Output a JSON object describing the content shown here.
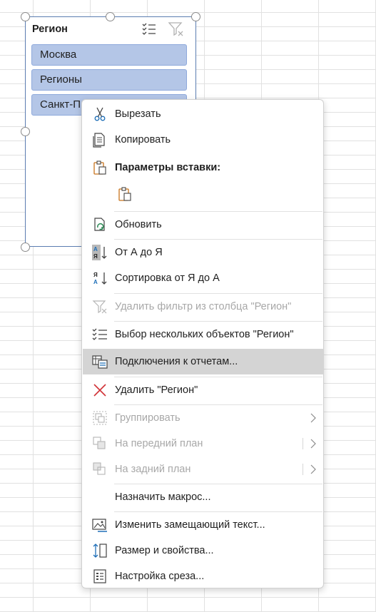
{
  "slicer": {
    "title": "Регион",
    "items": [
      {
        "label": "Москва",
        "selected": true
      },
      {
        "label": "Регионы",
        "selected": true
      },
      {
        "label": "Санкт-П",
        "selected": true
      }
    ],
    "icons": [
      "multi-select-icon",
      "clear-filter-icon"
    ]
  },
  "menu": {
    "items": [
      {
        "label": "Вырезать",
        "icon": "scissors-icon",
        "enabled": true
      },
      {
        "label": "Копировать",
        "icon": "copy-icon",
        "enabled": true
      },
      {
        "label": "Параметры вставки:",
        "icon": "paste-icon",
        "enabled": true
      },
      {
        "label": "",
        "icon": "paste-option-icon",
        "enabled": true
      },
      {
        "label": "Обновить",
        "icon": "refresh-icon",
        "enabled": true
      },
      {
        "label": "От А до Я",
        "icon": "sort-az-icon",
        "enabled": true
      },
      {
        "label": "Сортировка от Я до А",
        "icon": "sort-za-icon",
        "enabled": true
      },
      {
        "label": "Удалить фильтр из столбца \"Регион\"",
        "icon": "clear-filter-icon",
        "enabled": false
      },
      {
        "label": "Выбор нескольких объектов \"Регион\"",
        "icon": "multi-select-icon",
        "enabled": true
      },
      {
        "label": "Подключения к отчетам...",
        "icon": "report-connections-icon",
        "enabled": true,
        "highlighted": true
      },
      {
        "label": "Удалить \"Регион\"",
        "icon": "delete-icon",
        "enabled": true
      },
      {
        "label": "Группировать",
        "icon": "group-icon",
        "enabled": false,
        "submenu": true
      },
      {
        "label": "На передний план",
        "icon": "bring-forward-icon",
        "enabled": false,
        "submenu": true
      },
      {
        "label": "На задний план",
        "icon": "send-backward-icon",
        "enabled": false,
        "submenu": true
      },
      {
        "label": "Назначить макрос...",
        "icon": "",
        "enabled": true
      },
      {
        "label": "Изменить замещающий текст...",
        "icon": "alt-text-icon",
        "enabled": true
      },
      {
        "label": "Размер и свойства...",
        "icon": "size-properties-icon",
        "enabled": true
      },
      {
        "label": "Настройка среза...",
        "icon": "slicer-settings-icon",
        "enabled": true
      }
    ]
  },
  "colors": {
    "slicer_item_fill": "#b4c6e7",
    "menu_highlight": "#d4d4d4",
    "disabled_text": "#a8a8a8",
    "delete_icon": "#d13438"
  }
}
